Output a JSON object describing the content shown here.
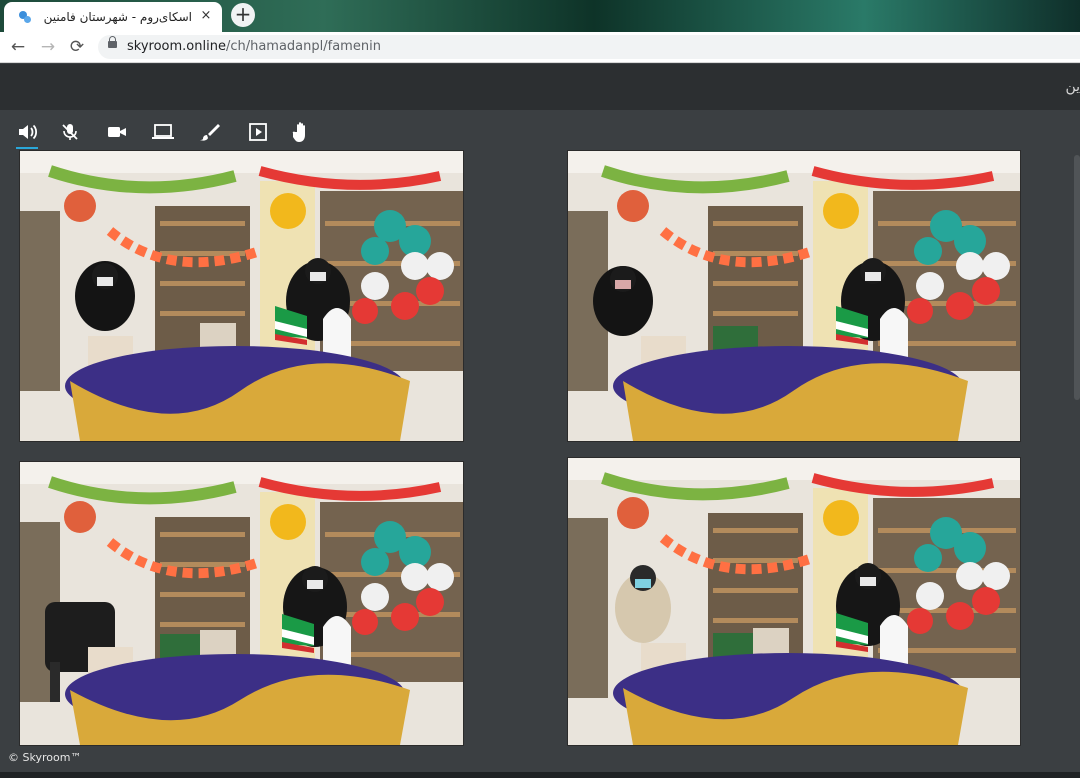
{
  "browser": {
    "tab_title": "اسکای‌روم - شهرستان فامنین",
    "tab_close": "×",
    "new_tab": "+",
    "url_domain": "skyroom.online",
    "url_path": "/ch/hamadanpl/famenin",
    "nav": {
      "back": "←",
      "forward": "→",
      "reload": "⟳"
    }
  },
  "room": {
    "header_title": "ین"
  },
  "toolbar": {
    "items": [
      {
        "icon": "speaker-icon",
        "active": true
      },
      {
        "icon": "mic-muted-icon",
        "active": false
      },
      {
        "icon": "camera-icon",
        "active": false
      },
      {
        "icon": "screen-share-icon",
        "active": false
      },
      {
        "icon": "brush-icon",
        "active": false
      },
      {
        "icon": "media-play-icon",
        "active": false
      },
      {
        "icon": "raise-hand-icon",
        "active": false
      }
    ]
  },
  "video_tiles": [
    {
      "scene": "library-two-hosts-table"
    },
    {
      "scene": "library-two-hosts-table"
    },
    {
      "scene": "library-host-empty-chair"
    },
    {
      "scene": "library-host-guest"
    }
  ],
  "footer": {
    "copyright": "© Skyroom™"
  },
  "colors": {
    "accent": "#2aa7d9",
    "background": "#3b3f42"
  }
}
